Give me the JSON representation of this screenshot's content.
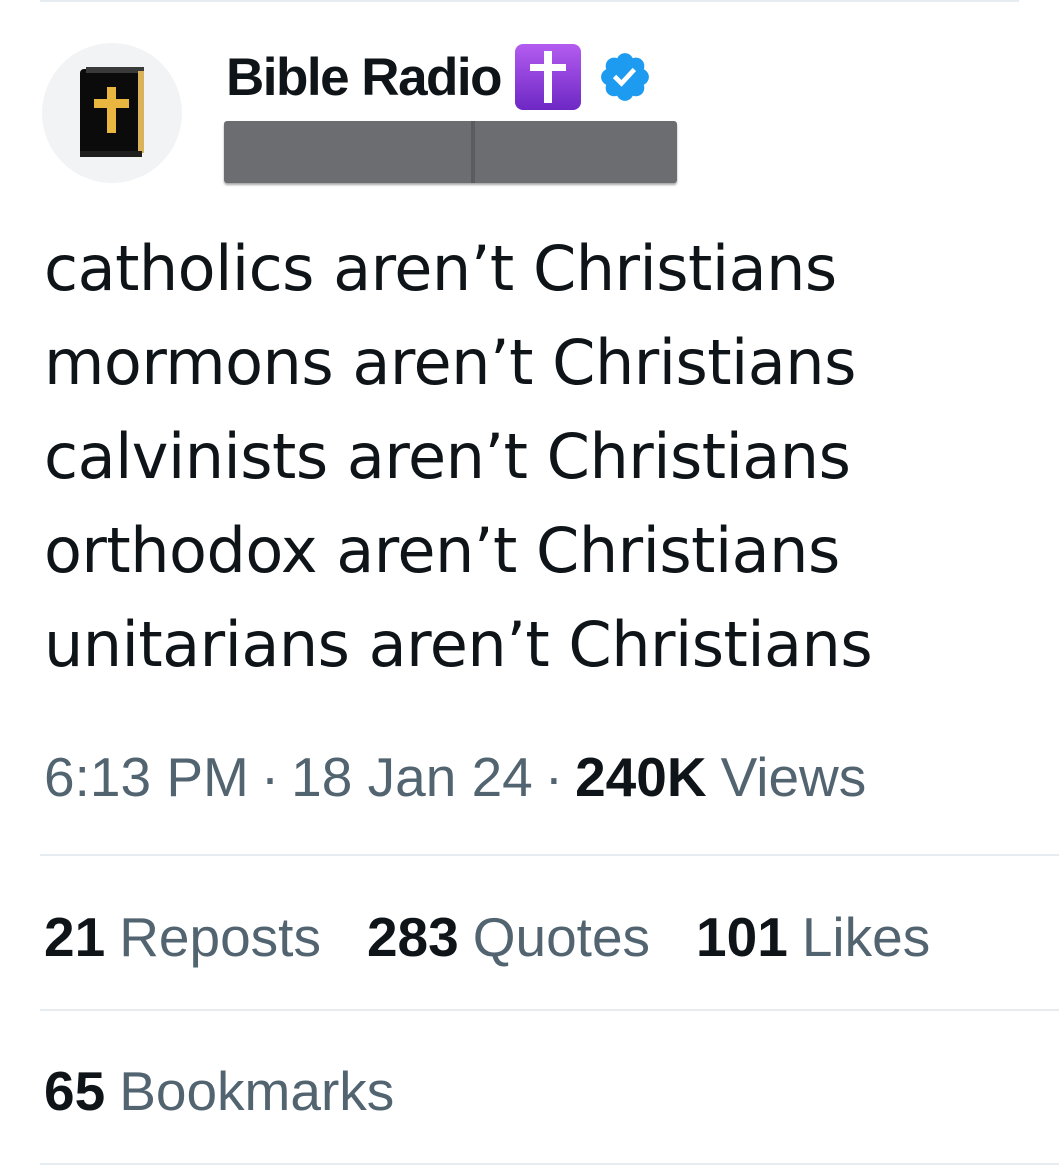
{
  "author": {
    "display_name": "Bible Radio",
    "name_emoji": "latin-cross-emoji",
    "verified_badge": "verified-badge-icon",
    "avatar_icon": "bible-book-icon",
    "handle_redacted": true
  },
  "tweet": {
    "lines": [
      "catholics aren’t Christians",
      "mormons aren’t Christians",
      "calvinists aren’t Christians",
      "orthodox aren’t Christians",
      "unitarians aren’t Christians"
    ]
  },
  "meta": {
    "time": "6:13 PM",
    "separator": "·",
    "date": "18 Jan 24",
    "views_count": "240K",
    "views_label": "Views"
  },
  "stats": {
    "reposts": {
      "count": "21",
      "label": "Reposts"
    },
    "quotes": {
      "count": "283",
      "label": "Quotes"
    },
    "likes": {
      "count": "101",
      "label": "Likes"
    },
    "bookmarks": {
      "count": "65",
      "label": "Bookmarks"
    }
  },
  "colors": {
    "text_primary": "#0f1419",
    "text_secondary": "#536471",
    "verified_blue": "#1d9bf0",
    "emoji_purple": "#8a3ad6",
    "divider": "#e6ecf0",
    "redaction_gray": "#6b6d70"
  }
}
